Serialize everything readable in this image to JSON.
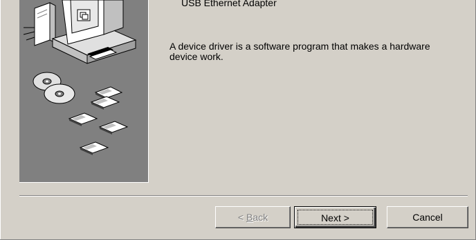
{
  "wizard": {
    "device_name": "USB Ethernet Adapter",
    "description": "A device driver is a software program that makes a hardware device work."
  },
  "buttons": {
    "back_prefix": "< ",
    "back_mnemonic": "B",
    "back_rest": "ack",
    "next_label": "Next >",
    "cancel_label": "Cancel"
  },
  "illustration": {
    "name": "hardware-wizard-illustration",
    "colors": {
      "background": "#808080",
      "monitor": "#c0c0c0",
      "screen": "#ffffff",
      "disc": "#e0e0e0",
      "floppy": "#ffffff"
    }
  },
  "colors": {
    "dialog_background": "#d4d0c8",
    "disabled_text": "#808080",
    "text": "#000000"
  }
}
